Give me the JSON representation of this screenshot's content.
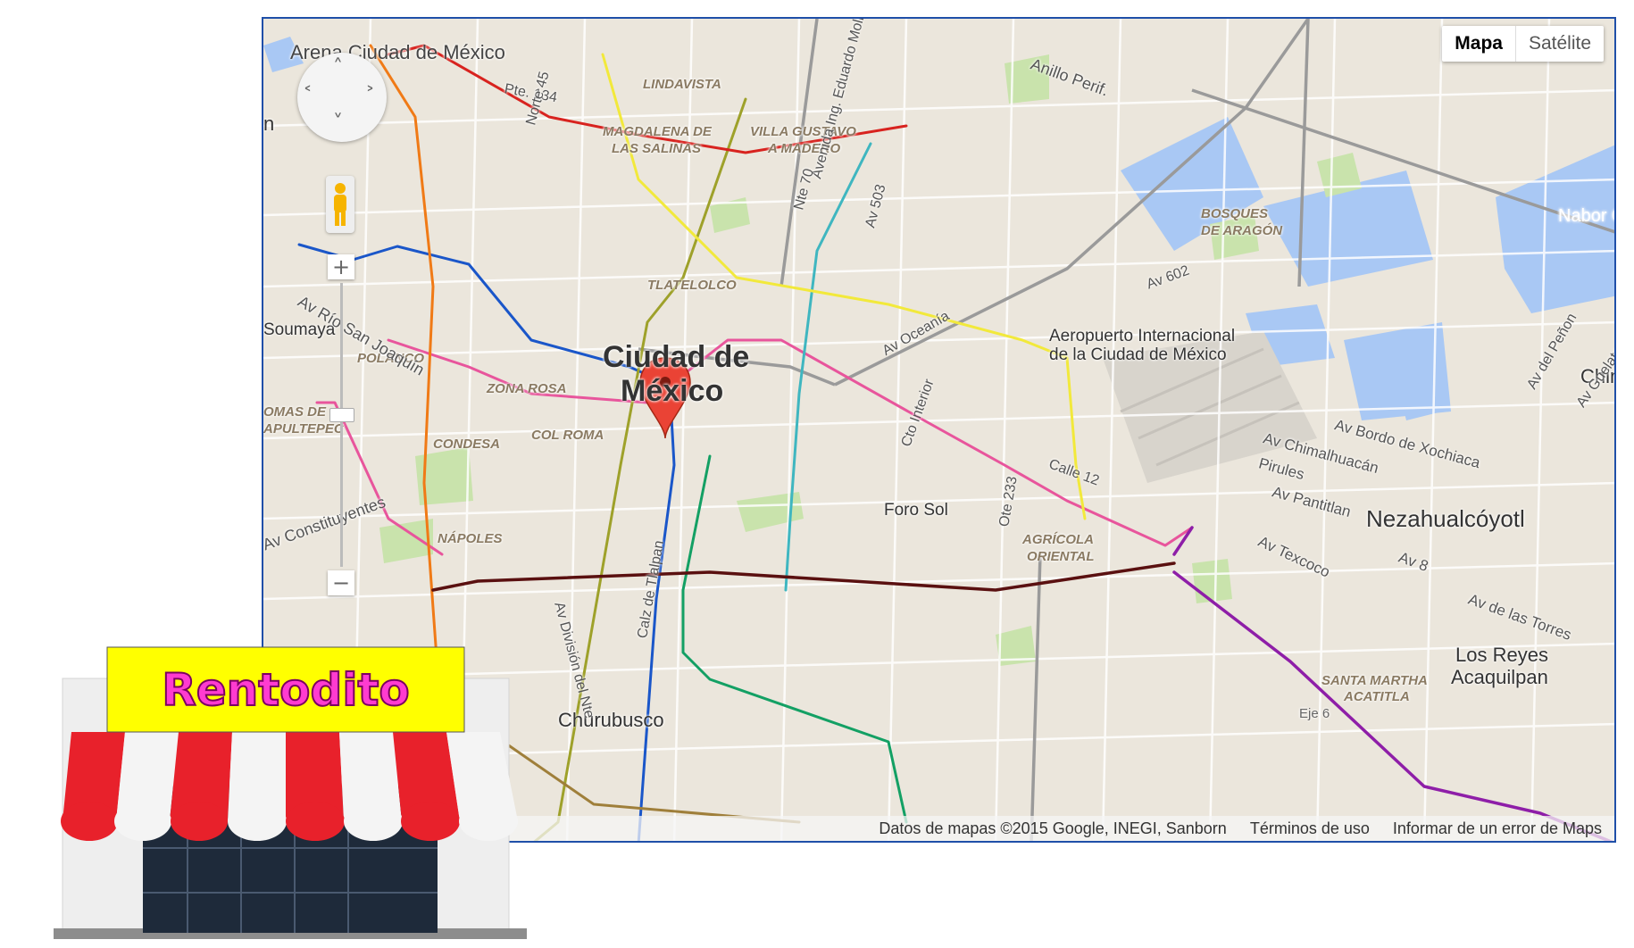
{
  "map": {
    "map_type_buttons": [
      "Mapa",
      "Satélite"
    ],
    "active_map_type": "Mapa",
    "marker": "Ciudad de México",
    "places": [
      "Arena Ciudad de México",
      "LINDAVISTA",
      "MAGDALENA DE",
      "LAS SALINAS",
      "VILLA GUSTAVO",
      "A MADERO",
      "BOSQUES",
      "DE ARAGÓN",
      "TLATELOLCO",
      "Ciudad de",
      "México",
      "Aeropuerto Internacional",
      "de la Ciudad de México",
      "Soumaya",
      "POLANCO",
      "ZONA ROSA",
      "CONDESA",
      "COL ROMA",
      "OMAS DE",
      "APULTEPEC",
      "NÁPOLES",
      "Foro Sol",
      "AGRÍCOLA",
      "ORIENTAL",
      "Nezahualcóyotl",
      "Los Reyes",
      "Acaquilpan",
      "SANTA MARTHA",
      "ACATITLA",
      "Churubusco",
      "Chim",
      "n",
      "Nabor Carr",
      "Eje 6"
    ],
    "streets": [
      "Anillo Perif.",
      "Pte. 134",
      "Norte 45",
      "Avenida Ing. Eduardo Molina",
      "Nte 70",
      "Av 503",
      "Av 602",
      "Av Oceanía",
      "Cto Interior",
      "Calle 12",
      "Ote 233",
      "Av Río San Joaquín",
      "Av Constituyentes",
      "Av División del Nte",
      "Calz de Tlalpan",
      "Av Bordo de Xochiaca",
      "Av Chimalhuacán",
      "Pirules",
      "Av Pantitlan",
      "Av Texcoco",
      "Av 8",
      "Av de las Torres",
      "Av del Peñon",
      "Av Guelatao"
    ],
    "footer": [
      "Datos de mapas ©2015 Google, INEGI, Sanborn",
      "Términos de uso",
      "Informar de un error de Maps"
    ]
  },
  "store": {
    "sign": "Rentodito"
  },
  "colors": {
    "line1": "#e8559c",
    "line2": "#1a56c9",
    "line3": "#9ea12a",
    "line4": "#3fb6c0",
    "line5": "#f2e93b",
    "line6": "#d8231f",
    "line7": "#f07a16",
    "line8": "#13a064",
    "line9": "#5a1010",
    "lineA": "#8e1ea8",
    "lineB": "#9f7f3a",
    "lineC": "#9c6a2a"
  }
}
